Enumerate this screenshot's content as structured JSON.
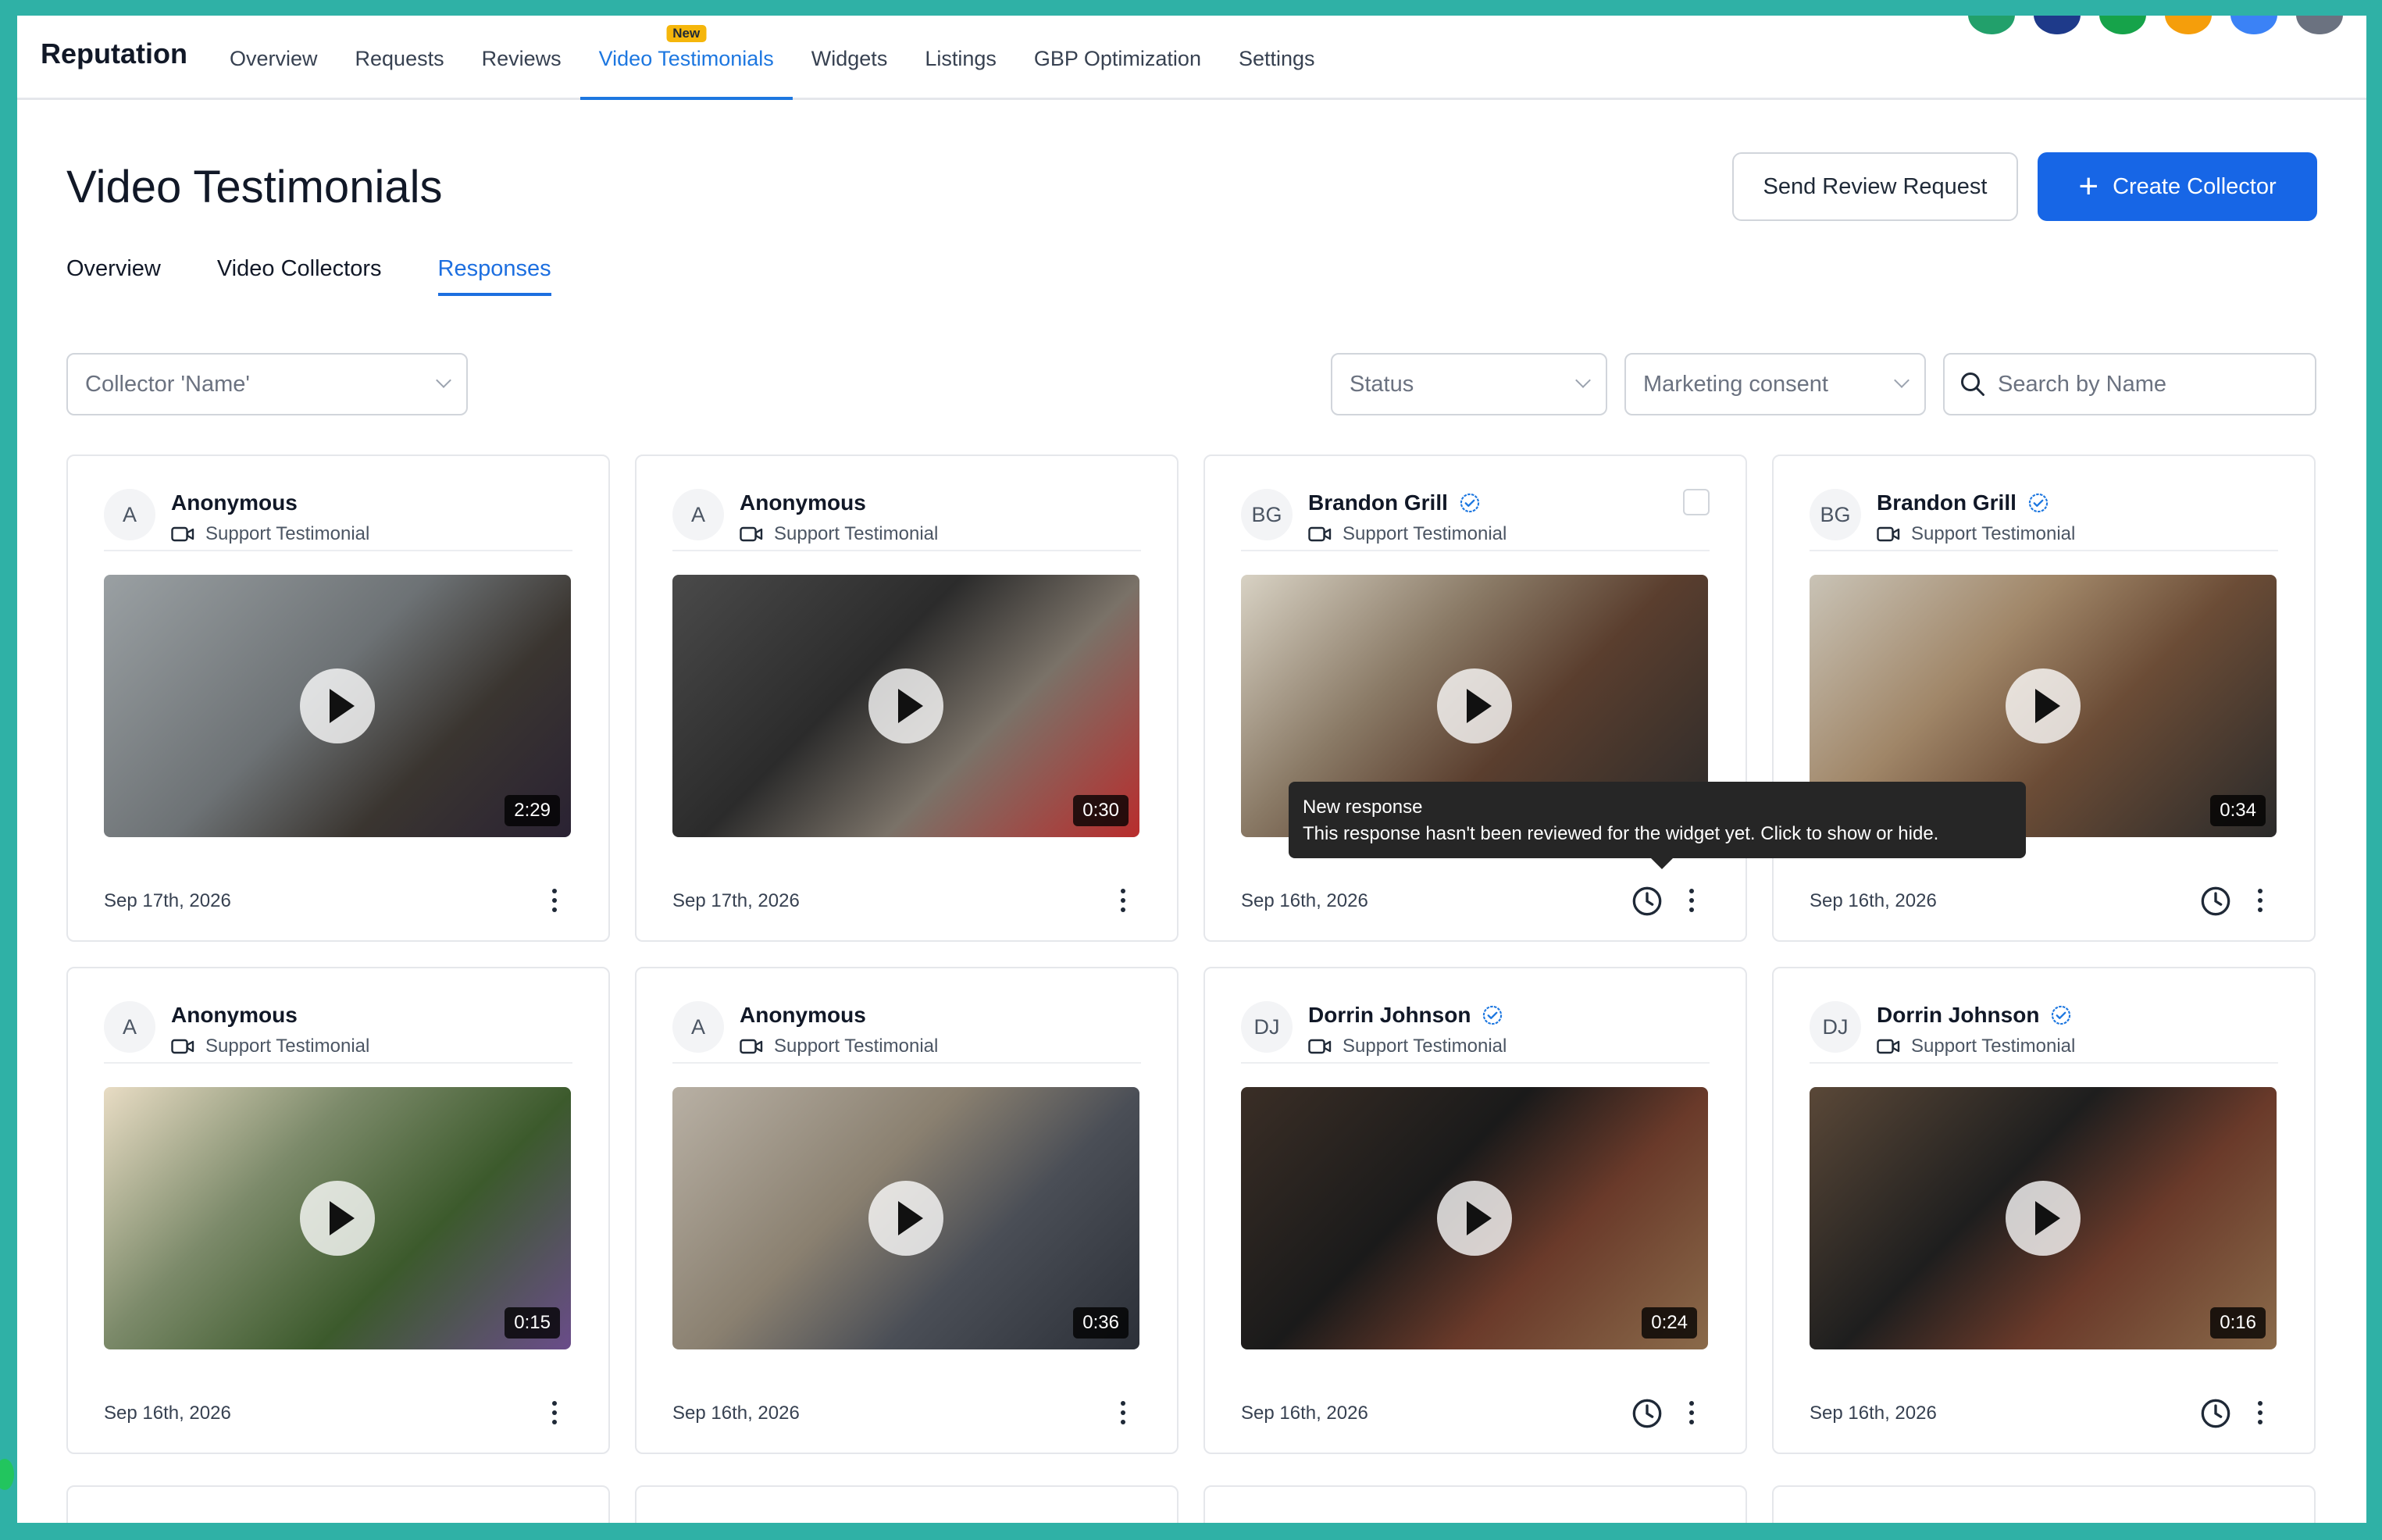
{
  "nav": {
    "brand": "Reputation",
    "links": [
      {
        "label": "Overview"
      },
      {
        "label": "Requests"
      },
      {
        "label": "Reviews"
      },
      {
        "label": "Video Testimonials",
        "badge": "New",
        "active": true
      },
      {
        "label": "Widgets"
      },
      {
        "label": "Listings"
      },
      {
        "label": "GBP Optimization"
      },
      {
        "label": "Settings"
      }
    ]
  },
  "header": {
    "title": "Video Testimonials",
    "send_request_label": "Send Review Request",
    "create_collector_label": "Create Collector"
  },
  "subtabs": [
    {
      "label": "Overview"
    },
    {
      "label": "Video Collectors"
    },
    {
      "label": "Responses",
      "active": true
    }
  ],
  "filters": {
    "collector": "Collector 'Name'",
    "status": "Status",
    "marketing": "Marketing consent",
    "search_placeholder": "Search by Name"
  },
  "tooltip": {
    "title": "New response",
    "body": "This response hasn't been reviewed for the widget yet. Click to show or hide."
  },
  "cards": [
    {
      "initials": "A",
      "name": "Anonymous",
      "subtitle": "Support Testimonial",
      "duration": "2:29",
      "date": "Sep 17th, 2026",
      "verified": false,
      "clock": false,
      "checkbox": false
    },
    {
      "initials": "A",
      "name": "Anonymous",
      "subtitle": "Support Testimonial",
      "duration": "0:30",
      "date": "Sep 17th, 2026",
      "verified": false,
      "clock": false,
      "checkbox": false
    },
    {
      "initials": "BG",
      "name": "Brandon Grill",
      "subtitle": "Support Testimonial",
      "duration": "",
      "date": "Sep 16th, 2026",
      "verified": true,
      "clock": true,
      "checkbox": true
    },
    {
      "initials": "BG",
      "name": "Brandon Grill",
      "subtitle": "Support Testimonial",
      "duration": "0:34",
      "date": "Sep 16th, 2026",
      "verified": true,
      "clock": true,
      "checkbox": false
    },
    {
      "initials": "A",
      "name": "Anonymous",
      "subtitle": "Support Testimonial",
      "duration": "0:15",
      "date": "Sep 16th, 2026",
      "verified": false,
      "clock": false,
      "checkbox": false
    },
    {
      "initials": "A",
      "name": "Anonymous",
      "subtitle": "Support Testimonial",
      "duration": "0:36",
      "date": "Sep 16th, 2026",
      "verified": false,
      "clock": false,
      "checkbox": false
    },
    {
      "initials": "DJ",
      "name": "Dorrin Johnson",
      "subtitle": "Support Testimonial",
      "duration": "0:24",
      "date": "Sep 16th, 2026",
      "verified": true,
      "clock": true,
      "checkbox": false
    },
    {
      "initials": "DJ",
      "name": "Dorrin Johnson",
      "subtitle": "Support Testimonial",
      "duration": "0:16",
      "date": "Sep 16th, 2026",
      "verified": true,
      "clock": true,
      "checkbox": false
    }
  ],
  "colors": {
    "accent": "#1766e6",
    "frame": "#2fb1a6"
  }
}
